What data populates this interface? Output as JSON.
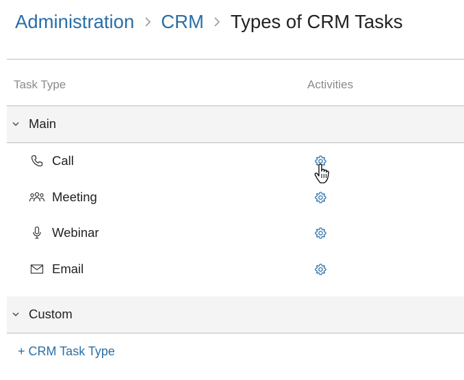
{
  "breadcrumb": {
    "items": [
      {
        "label": "Administration"
      },
      {
        "label": "CRM"
      }
    ],
    "current": "Types of CRM Tasks"
  },
  "table": {
    "columns": {
      "task_type": "Task Type",
      "activities": "Activities"
    },
    "groups": [
      {
        "label": "Main",
        "expanded": true,
        "tasks": [
          {
            "label": "Call",
            "icon": "phone-icon"
          },
          {
            "label": "Meeting",
            "icon": "people-icon"
          },
          {
            "label": "Webinar",
            "icon": "microphone-icon"
          },
          {
            "label": "Email",
            "icon": "envelope-icon"
          }
        ]
      },
      {
        "label": "Custom",
        "expanded": true,
        "tasks": []
      }
    ]
  },
  "actions": {
    "add_task_type": "+ CRM Task Type"
  },
  "colors": {
    "link": "#2a6ea6",
    "group_bg": "#f4f4f4",
    "header_text": "#8a8a8a",
    "border": "#bdbdbd"
  },
  "cursor": {
    "icon": "hand-pointer-icon"
  }
}
